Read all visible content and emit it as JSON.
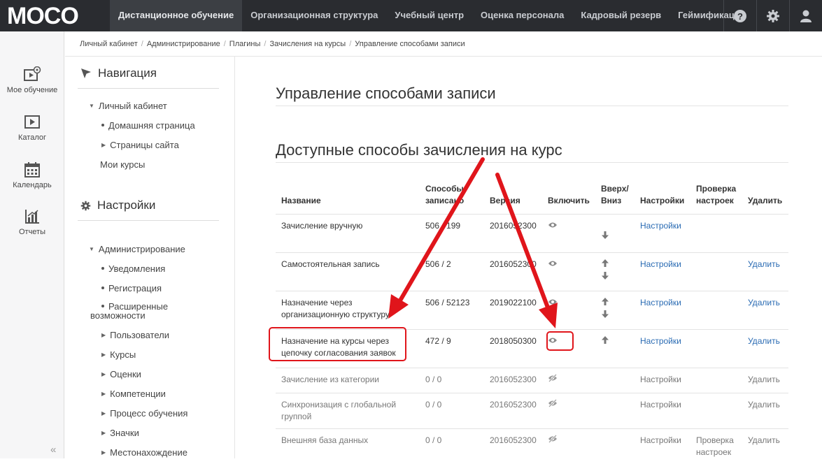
{
  "app": {
    "logo_text": "MOCO"
  },
  "topnav": [
    {
      "label": "Дистанционное обучение",
      "active": true
    },
    {
      "label": "Организационная структура"
    },
    {
      "label": "Учебный центр"
    },
    {
      "label": "Оценка персонала"
    },
    {
      "label": "Кадровый резерв"
    },
    {
      "label": "Геймификация"
    }
  ],
  "topicons": [
    "help-icon",
    "gear-icon",
    "user-icon"
  ],
  "breadcrumb": [
    "Личный кабинет",
    "Администрирование",
    "Плагины",
    "Зачисления на курсы",
    "Управление способами записи"
  ],
  "rail": [
    {
      "label": "Мое обучение",
      "icon": "my-learning-icon"
    },
    {
      "label": "Каталог",
      "icon": "catalog-icon"
    },
    {
      "label": "Календарь",
      "icon": "calendar-icon"
    },
    {
      "label": "Отчеты",
      "icon": "reports-icon"
    }
  ],
  "rail_collapse": "«",
  "nav_block": {
    "title": "Навигация",
    "root": "Личный кабинет",
    "children": [
      "Домашняя страница",
      "Страницы сайта"
    ],
    "my_courses": "Мои курсы"
  },
  "settings_block": {
    "title": "Настройки",
    "root": "Администрирование",
    "items": [
      "Уведомления",
      "Регистрация",
      "Расширенные",
      "Пользователи",
      "Курсы",
      "Оценки",
      "Компетенции",
      "Процесс обучения",
      "Значки",
      "Местонахождение"
    ],
    "item_cont": "возможности"
  },
  "main": {
    "page_title": "Управление способами записи",
    "section_title": "Доступные способы зачисления на курс",
    "headers": {
      "name": "Название",
      "methods_1": "Способы",
      "methods_2": "записано",
      "version": "Версия",
      "enable": "Включить",
      "order_1": "Вверх/",
      "order_2": "Вниз",
      "settings": "Настройки",
      "check_1": "Проверка",
      "check_2": "настроек",
      "delete": "Удалить"
    },
    "rows": [
      {
        "name1": "Зачисление вручную",
        "name2": "",
        "count": "506 / 199",
        "version": "2016052300",
        "settings": "Настройки",
        "delete": "",
        "check1": "",
        "check2": ""
      },
      {
        "name1": "Самостоятельная запись",
        "name2": "",
        "count": "506 / 2",
        "version": "2016052300",
        "settings": "Настройки",
        "delete": "Удалить",
        "check1": "",
        "check2": ""
      },
      {
        "name1": "Назначение через",
        "name2": "организационную структуру",
        "count": "506 / 52123",
        "version": "2019022100",
        "settings": "Настройки",
        "delete": "Удалить",
        "check1": "",
        "check2": ""
      },
      {
        "name1": "Назначение на курсы через",
        "name2": "цепочку согласования заявок",
        "count": "472 / 9",
        "version": "2018050300",
        "settings": "Настройки",
        "delete": "Удалить",
        "check1": "",
        "check2": ""
      },
      {
        "name1": "Зачисление из категории",
        "name2": "",
        "count": "0 / 0",
        "version": "2016052300",
        "settings": "Настройки",
        "delete": "Удалить",
        "check1": "",
        "check2": ""
      },
      {
        "name1": "Синхронизация с глобальной",
        "name2": "группой",
        "count": "0 / 0",
        "version": "2016052300",
        "settings": "Настройки",
        "delete": "Удалить",
        "check1": "",
        "check2": ""
      },
      {
        "name1": "Внешняя база данных",
        "name2": "",
        "count": "0 / 0",
        "version": "2016052300",
        "settings": "Настройки",
        "delete": "Удалить",
        "check1": "Проверка",
        "check2": "настроек"
      }
    ]
  },
  "colors": {
    "topbar": "#2a2c30",
    "link": "#2a6bb3",
    "annotation": "#e0151b"
  }
}
